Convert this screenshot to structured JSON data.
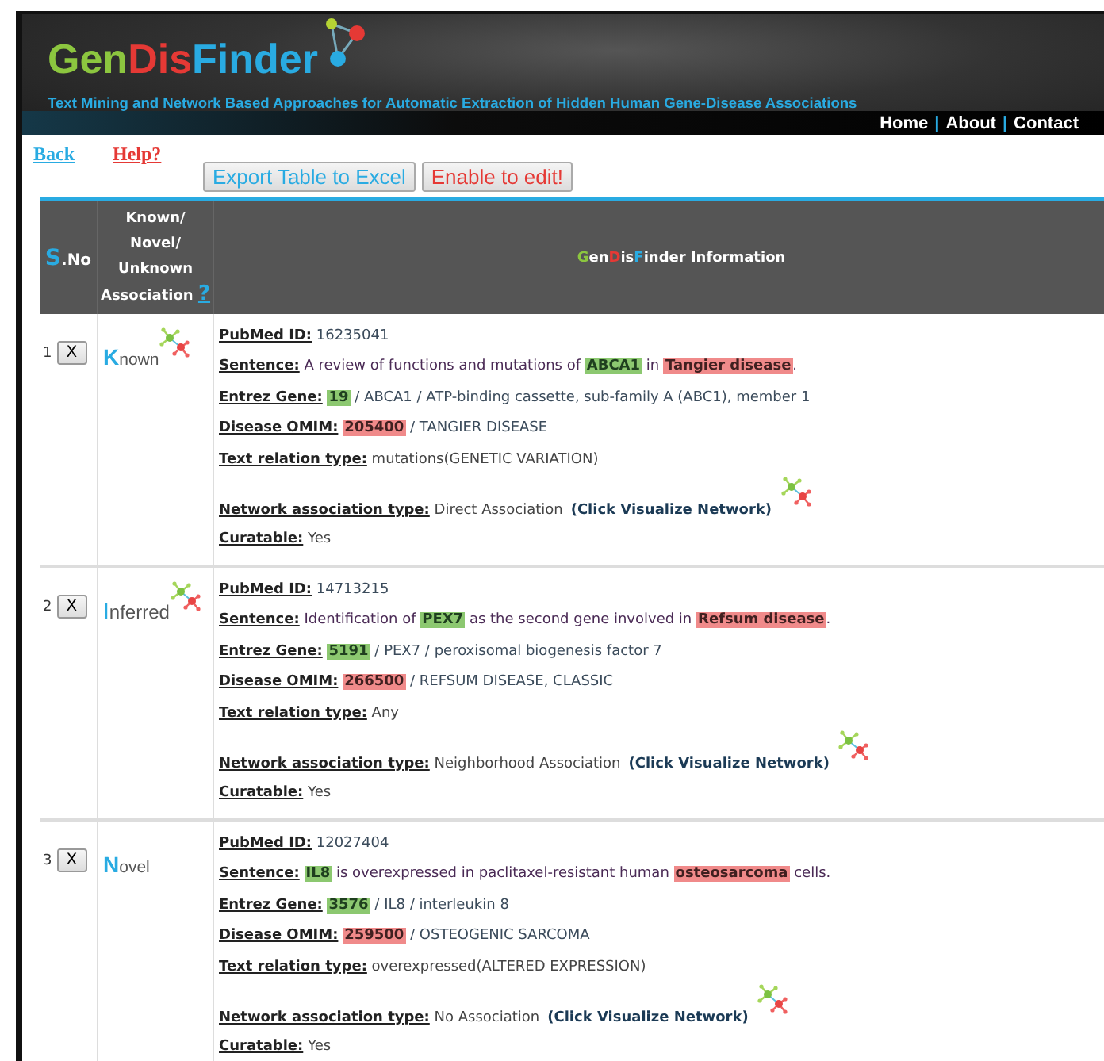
{
  "header": {
    "logo": [
      {
        "text": "Gen",
        "kind": "green"
      },
      {
        "text": "Dis",
        "kind": "red"
      },
      {
        "text": "Finder",
        "kind": "blue"
      }
    ],
    "tagline": "Text Mining and Network Based Approaches for Automatic Extraction of Hidden Human Gene-Disease Associations",
    "nav": [
      {
        "text": "Home",
        "kind": "link"
      },
      {
        "text": "|",
        "kind": "separator"
      },
      {
        "text": "About",
        "kind": "link"
      },
      {
        "text": "|",
        "kind": "separator"
      },
      {
        "text": "Contact",
        "kind": "link"
      }
    ]
  },
  "links": {
    "back": "Back",
    "help": "Help?"
  },
  "buttons": [
    {
      "label": "Export Table to Excel",
      "kind": "export"
    },
    {
      "label": "Enable to edit!",
      "kind": "edit"
    }
  ],
  "table": {
    "columns": {
      "sno": {
        "initial": "S",
        "rest": ".No"
      },
      "association": {
        "lines": [
          "Known/",
          "Novel/",
          "Unknown",
          "Association"
        ],
        "help": "?"
      },
      "info": [
        {
          "text": "G",
          "kind": "green"
        },
        {
          "text": "en",
          "kind": "plain"
        },
        {
          "text": "D",
          "kind": "red"
        },
        {
          "text": "is",
          "kind": "plain"
        },
        {
          "text": "F",
          "kind": "blue"
        },
        {
          "text": "inder Information",
          "kind": "plain"
        }
      ]
    },
    "rows": [
      {
        "labels": {
          "pubmed": "PubMed ID:",
          "sentence": "Sentence:",
          "gene": "Entrez Gene:",
          "disease": "Disease OMIM:",
          "relation": "Text relation type:",
          "network": "Network association type:",
          "curatable": "Curatable:"
        },
        "number": "1",
        "delete": "X",
        "association": {
          "initial": "K",
          "rest": "nown",
          "kind": "known"
        },
        "pubmed": "16235041",
        "sentence": [
          {
            "text": "A review of functions and mutations of ",
            "kind": "plain"
          },
          {
            "text": "ABCA1",
            "kind": "gene"
          },
          {
            "text": " in ",
            "kind": "plain"
          },
          {
            "text": "Tangier disease",
            "kind": "disease"
          },
          {
            "text": ".",
            "kind": "plain"
          }
        ],
        "gene_id": "19",
        "gene_rest": " / ABCA1 / ATP-binding cassette, sub-family A (ABC1), member 1",
        "disease_id": "205400",
        "disease_rest": " / TANGIER DISEASE",
        "relation": "mutations(GENETIC VARIATION)",
        "network": "Direct Association",
        "network_link": "(Click Visualize Network)",
        "curatable": "Yes"
      },
      {
        "labels": {
          "pubmed": "PubMed ID:",
          "sentence": "Sentence:",
          "gene": "Entrez Gene:",
          "disease": "Disease OMIM:",
          "relation": "Text relation type:",
          "network": "Network association type:",
          "curatable": "Curatable:"
        },
        "number": "2",
        "delete": "X",
        "association": {
          "initial": "I",
          "rest": "nferred",
          "kind": "inferred"
        },
        "pubmed": "14713215",
        "sentence": [
          {
            "text": "Identification of ",
            "kind": "plain"
          },
          {
            "text": "PEX7",
            "kind": "gene"
          },
          {
            "text": " as the second gene involved in ",
            "kind": "plain"
          },
          {
            "text": "Refsum disease",
            "kind": "disease"
          },
          {
            "text": ".",
            "kind": "plain"
          }
        ],
        "gene_id": "5191",
        "gene_rest": " / PEX7 / peroxisomal biogenesis factor 7",
        "disease_id": "266500",
        "disease_rest": " / REFSUM DISEASE, CLASSIC",
        "relation": "Any",
        "network": "Neighborhood Association",
        "network_link": "(Click Visualize Network)",
        "curatable": "Yes"
      },
      {
        "labels": {
          "pubmed": "PubMed ID:",
          "sentence": "Sentence:",
          "gene": "Entrez Gene:",
          "disease": "Disease OMIM:",
          "relation": "Text relation type:",
          "network": "Network association type:",
          "curatable": "Curatable:"
        },
        "number": "3",
        "delete": "X",
        "association": {
          "initial": "N",
          "rest": "ovel",
          "kind": "novel"
        },
        "pubmed": "12027404",
        "sentence": [
          {
            "text": "IL8",
            "kind": "gene"
          },
          {
            "text": " is overexpressed in paclitaxel-resistant human ",
            "kind": "plain"
          },
          {
            "text": "osteosarcoma",
            "kind": "disease"
          },
          {
            "text": " cells.",
            "kind": "plain"
          }
        ],
        "gene_id": "3576",
        "gene_rest": " / IL8 / interleukin 8",
        "disease_id": "259500",
        "disease_rest": " / OSTEOGENIC SARCOMA",
        "relation": "overexpressed(ALTERED EXPRESSION)",
        "network": "No Association",
        "network_link": "(Click Visualize Network)",
        "curatable": "Yes"
      }
    ]
  }
}
